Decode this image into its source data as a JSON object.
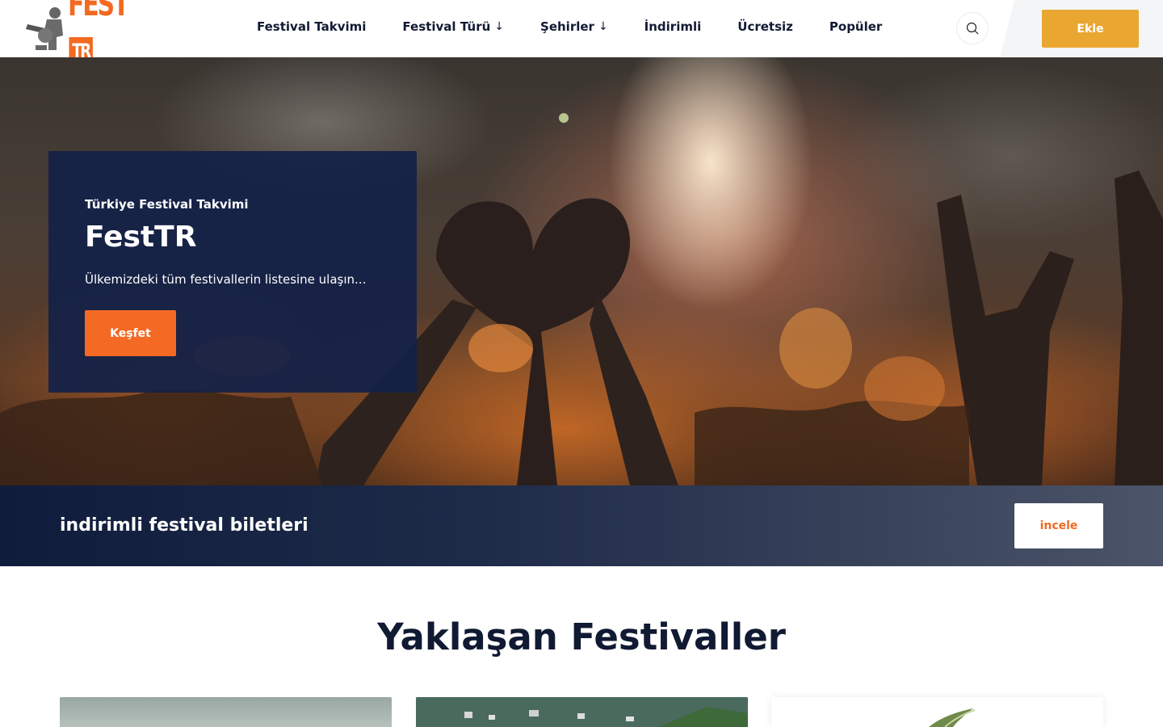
{
  "header": {
    "logo_text": "FEST",
    "logo_badge": "TR",
    "nav": [
      {
        "label": "Festival Takvimi",
        "dropdown": false
      },
      {
        "label": "Festival Türü",
        "dropdown": true
      },
      {
        "label": "Şehirler",
        "dropdown": true
      },
      {
        "label": "İndirimli",
        "dropdown": false
      },
      {
        "label": "Ücretsiz",
        "dropdown": false
      },
      {
        "label": "Popüler",
        "dropdown": false
      }
    ],
    "search_icon": "search-icon",
    "add_label": "Ekle"
  },
  "hero": {
    "eyebrow": "Türkiye Festival Takvimi",
    "title": "FestTR",
    "description": "Ülkemizdeki tüm festivallerin listesine ulaşın...",
    "button_label": "Keşfet"
  },
  "banner": {
    "text": "indirimli festival biletleri",
    "button_label": "incele"
  },
  "section": {
    "title": "Yaklaşan Festivaller"
  },
  "colors": {
    "brand_orange": "#f26a21",
    "add_button": "#e9a631",
    "navy": "#122148"
  }
}
